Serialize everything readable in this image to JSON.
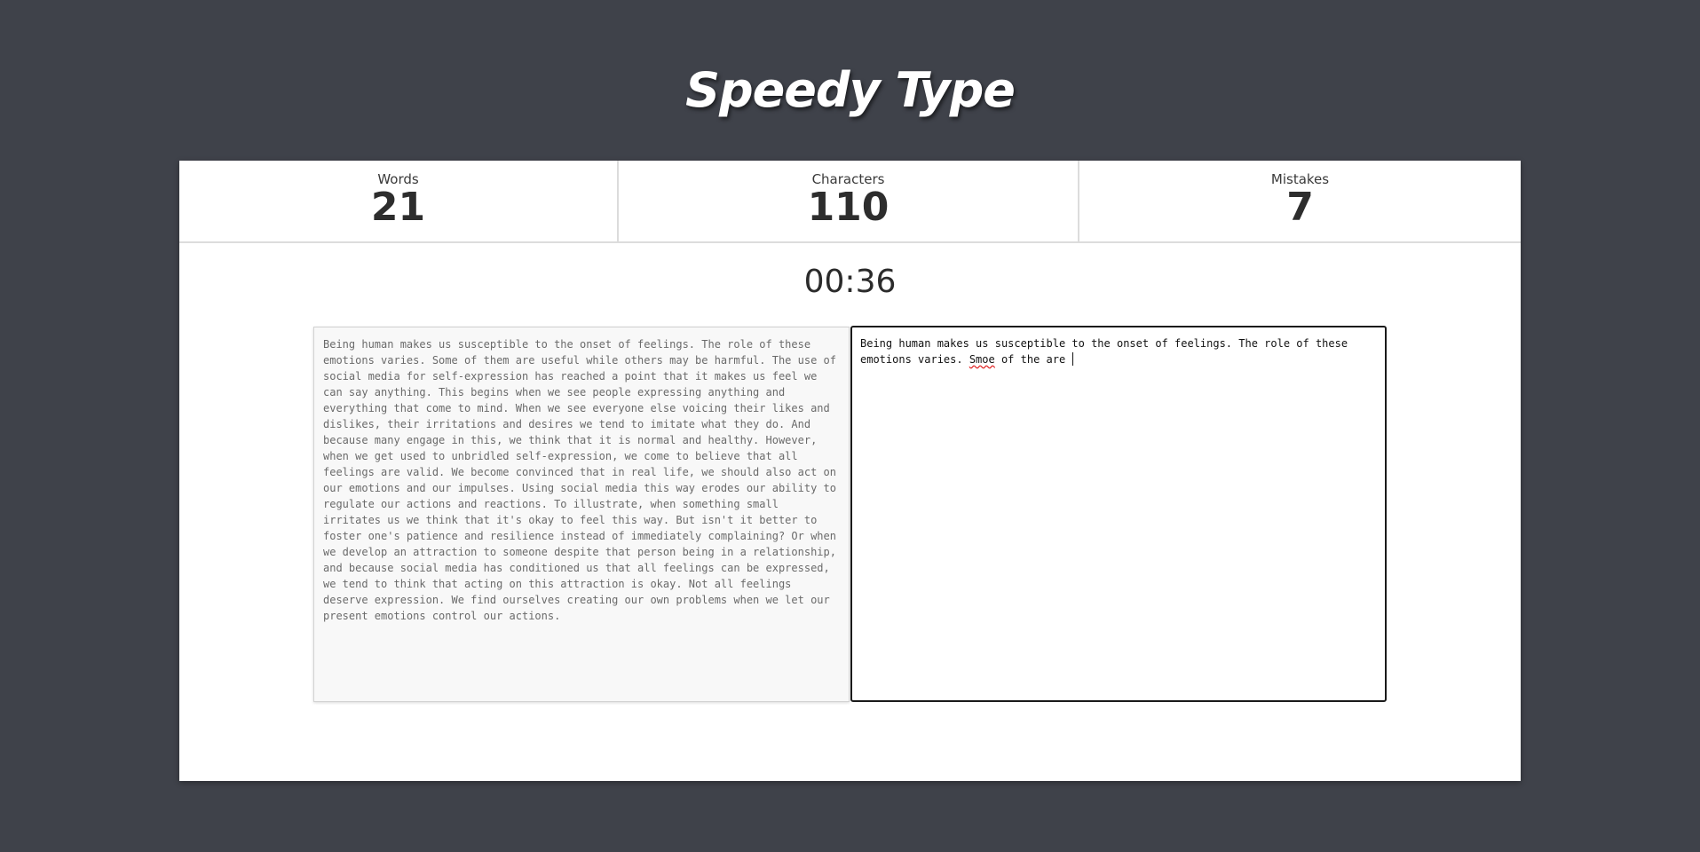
{
  "app": {
    "title": "Speedy Type"
  },
  "stats": {
    "words": {
      "label": "Words",
      "value": "21"
    },
    "characters": {
      "label": "Characters",
      "value": "110"
    },
    "mistakes": {
      "label": "Mistakes",
      "value": "7"
    }
  },
  "timer": "00:36",
  "source_text": "Being human makes us susceptible to the onset of feelings. The role of these emotions varies. Some of them are useful while others may be harmful. The use of social media for self-expression has reached a point that it makes us feel we can say anything. This begins when we see people expressing anything and everything that come to mind. When we see everyone else voicing their likes and dislikes, their irritations and desires we tend to imitate what they do. And because many engage in this, we think that it is normal and healthy. However, when we get used to unbridled self-expression, we come to believe that all feelings are valid. We become convinced that in real life, we should also act on our emotions and our impulses. Using social media this way erodes our ability to regulate our actions and reactions. To illustrate, when something small irritates us we think that it's okay to feel this way. But isn't it better to foster one's patience and resilience instead of immediately complaining? Or when we develop an attraction to someone despite that person being in a relationship, and because social media has conditioned us that all feelings can be expressed, we tend to think that acting on this attraction is okay. Not all feelings deserve expression. We find ourselves creating our own problems when we let our present emotions control our actions.",
  "typed": {
    "before": "Being human makes us susceptible to the onset of feelings. The role of these emotions varies. ",
    "misspelled": "Smoe",
    "after": " of the are "
  },
  "colors": {
    "page_background": "#3f424a",
    "card_background": "#ffffff",
    "spellcheck_underline": "#e02020"
  }
}
